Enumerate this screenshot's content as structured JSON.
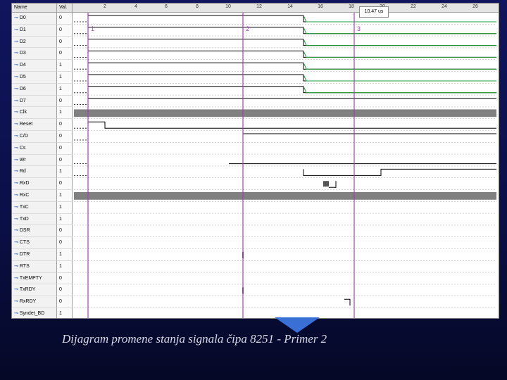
{
  "header": {
    "name_col": "Name",
    "value_col": "Val.",
    "ticks": [
      "2",
      "4",
      "6",
      "8",
      "10",
      "12",
      "14",
      "16",
      "18",
      "20",
      "22",
      "24",
      "26"
    ],
    "time_readout": "10.47 us"
  },
  "signals": [
    {
      "name": "D0",
      "value": "0"
    },
    {
      "name": "D1",
      "value": "0"
    },
    {
      "name": "D2",
      "value": "0"
    },
    {
      "name": "D3",
      "value": "0"
    },
    {
      "name": "D4",
      "value": "1"
    },
    {
      "name": "D5",
      "value": "1"
    },
    {
      "name": "D6",
      "value": "1"
    },
    {
      "name": "D7",
      "value": "0"
    },
    {
      "name": "Clk",
      "value": "1"
    },
    {
      "name": "Reset",
      "value": "0"
    },
    {
      "name": "C/D",
      "value": "0"
    },
    {
      "name": "Cs",
      "value": "0"
    },
    {
      "name": "Wr",
      "value": "0"
    },
    {
      "name": "Rd",
      "value": "1"
    },
    {
      "name": "RxD",
      "value": "0"
    },
    {
      "name": "RxC",
      "value": "1"
    },
    {
      "name": "TxC",
      "value": "1"
    },
    {
      "name": "TxD",
      "value": "1"
    },
    {
      "name": "DSR",
      "value": "0"
    },
    {
      "name": "CTS",
      "value": "0"
    },
    {
      "name": "DTR",
      "value": "1"
    },
    {
      "name": "RTS",
      "value": "1"
    },
    {
      "name": "TxEMPTY",
      "value": "0"
    },
    {
      "name": "TxRDY",
      "value": "0"
    },
    {
      "name": "RxRDY",
      "value": "0"
    },
    {
      "name": "Syndet_BD",
      "value": "1"
    }
  ],
  "markers": [
    {
      "label": "1"
    },
    {
      "label": "2"
    },
    {
      "label": "3"
    }
  ],
  "caption": "Dijagram promene stanja signala čipa 8251 - Primer 2",
  "colors": {
    "marker": "#a23fb8",
    "wave": "#000000",
    "bus_wave": "#1e9d34",
    "clock_band": "#808080",
    "grid": "#b8b8b8",
    "background_top": "#10155e",
    "background_bottom": "#050826",
    "accent": "#3a6fd6"
  }
}
